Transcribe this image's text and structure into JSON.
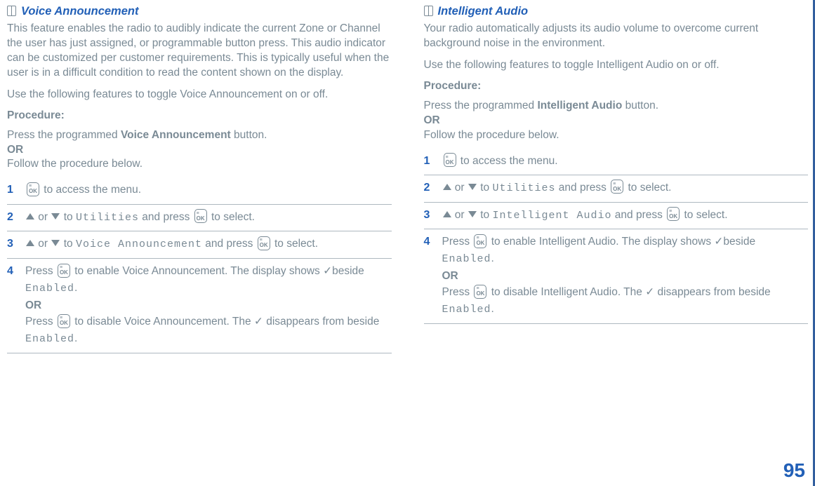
{
  "left": {
    "title": "Voice Announcement",
    "para1": "This feature enables the radio to audibly indicate the current Zone or Channel the user has just assigned, or programmable button press. This audio indicator can be customized per customer requirements. This is typically useful when the user is in a difficult condition to read the content shown on the display.",
    "para2": "Use the following features to toggle Voice Announcement on or off.",
    "proc_label": "Procedure:",
    "alt_line1_a": "Press the programmed ",
    "alt_line1_b": "Voice Announcement",
    "alt_line1_c": " button.",
    "or": "OR",
    "alt_line2": "Follow the procedure below.",
    "steps": [
      {
        "n": "1",
        "text_a": " to access the menu."
      },
      {
        "n": "2",
        "or": " or ",
        "to": " to ",
        "target": "Utilities",
        "andpress": " and press ",
        "tosel": " to select."
      },
      {
        "n": "3",
        "or": " or ",
        "to": " to ",
        "target": "Voice Announcement",
        "andpress": " and press ",
        "tosel": " to select."
      },
      {
        "n": "4",
        "a": "Press ",
        "b": " to enable Voice Announcement. The display shows ",
        "c": "beside ",
        "enabled": "Enabled",
        "d": ".",
        "or": "OR",
        "e": "Press ",
        "f": " to disable Voice Announcement. The ",
        "g": " disappears from beside ",
        "h": "."
      }
    ]
  },
  "right": {
    "title": "Intelligent Audio",
    "para1": "Your radio automatically adjusts its audio volume to overcome current background noise in the environment.",
    "para2": "Use the following features to toggle Intelligent Audio on or off.",
    "proc_label": "Procedure:",
    "alt_line1_a": "Press the programmed ",
    "alt_line1_b": "Intelligent Audio",
    "alt_line1_c": " button.",
    "or": "OR",
    "alt_line2": "Follow the procedure below.",
    "steps": [
      {
        "n": "1",
        "text_a": " to access the menu."
      },
      {
        "n": "2",
        "or": " or ",
        "to": " to ",
        "target": "Utilities",
        "andpress": " and press ",
        "tosel": " to select."
      },
      {
        "n": "3",
        "or": " or ",
        "to": " to ",
        "target": "Intelligent Audio",
        "andpress": " and press ",
        "tosel": " to select."
      },
      {
        "n": "4",
        "a": "Press ",
        "b": " to enable Intelligent Audio. The display shows ",
        "c": "beside ",
        "enabled": "Enabled",
        "d": ".",
        "or": "OR",
        "e": "Press ",
        "f": " to disable Intelligent Audio. The ",
        "g": " disappears from beside ",
        "h": "."
      }
    ]
  },
  "page": "95",
  "glyphs": {
    "check": "✓"
  }
}
